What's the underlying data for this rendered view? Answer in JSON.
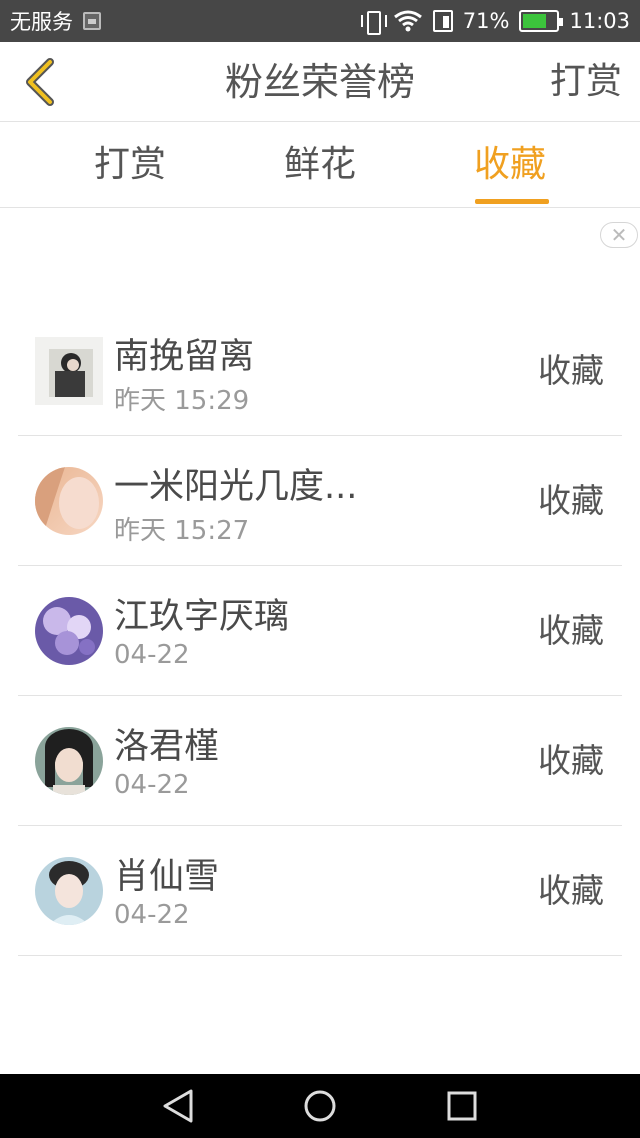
{
  "status_bar": {
    "carrier": "无服务",
    "battery_percent": "71%",
    "battery_level": 0.71,
    "time": "11:03",
    "icons": [
      "sim-icon",
      "vibrate-icon",
      "wifi-icon",
      "sim-card-icon",
      "battery-icon"
    ]
  },
  "header": {
    "back_icon": "chevron-left-icon",
    "title": "粉丝荣誉榜",
    "action_label": "打赏"
  },
  "tabs": [
    {
      "label": "打赏",
      "active": false
    },
    {
      "label": "鲜花",
      "active": false
    },
    {
      "label": "收藏",
      "active": true
    }
  ],
  "ad": {
    "close_icon": "close-icon",
    "close_glyph": "✕"
  },
  "fans": [
    {
      "name": "南挽留离",
      "time": "昨天 15:29",
      "action": "收藏"
    },
    {
      "name": "一米阳光几度...",
      "time": "昨天 15:27",
      "action": "收藏"
    },
    {
      "name": "江玖字厌璃",
      "time": "04-22",
      "action": "收藏"
    },
    {
      "name": "洛君槿",
      "time": "04-22",
      "action": "收藏"
    },
    {
      "name": "肖仙雪",
      "time": "04-22",
      "action": "收藏"
    }
  ],
  "nav": [
    "back-icon",
    "home-icon",
    "recents-icon"
  ],
  "colors": {
    "accent": "#f0a020",
    "status_bar": "#474747",
    "divider": "#e3e3e3",
    "text": "#4a4a4a",
    "subtext": "#9a9a9a"
  }
}
